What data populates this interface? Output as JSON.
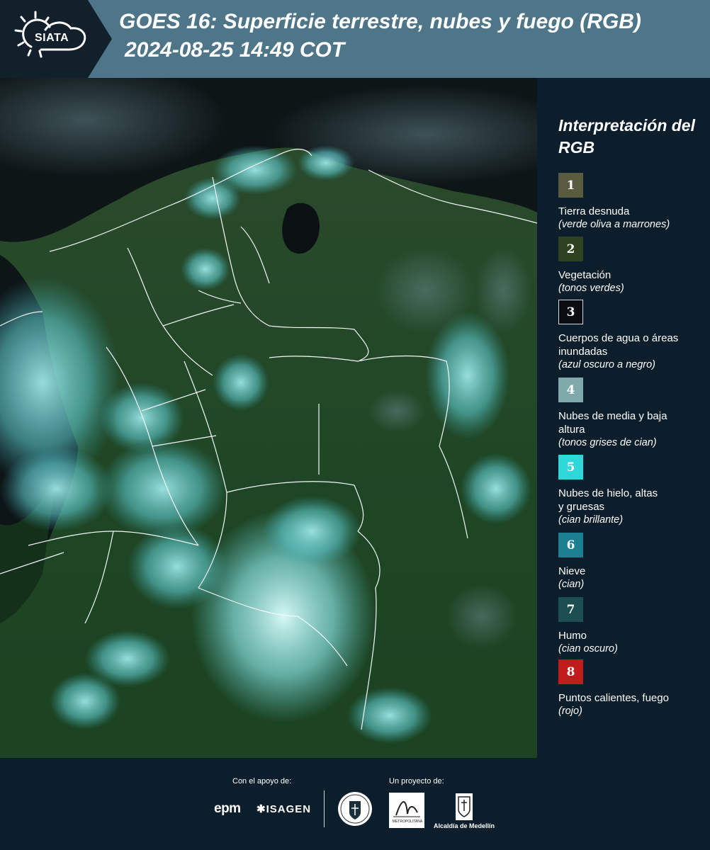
{
  "header": {
    "logo_text": "SIATA",
    "title_line1": "GOES 16: Superficie terrestre, nubes y fuego (RGB)",
    "title_line2": "2024-08-25 14:49 COT"
  },
  "legend": {
    "title": "Interpretación del RGB",
    "items": [
      {
        "number": "1",
        "label": "Tierra desnuda",
        "sub": "(verde oliva a marrones)",
        "color": "#5a5a3e"
      },
      {
        "number": "2",
        "label": "Vegetación",
        "sub": "(tonos verdes)",
        "color": "#2e4222"
      },
      {
        "number": "3",
        "label": "Cuerpos de agua o áreas inundadas",
        "sub": "(azul oscuro a negro)",
        "color": "#0a0d12"
      },
      {
        "number": "4",
        "label": "Nubes de media y baja altura",
        "sub": "(tonos grises de cian)",
        "color": "#7fa9ab"
      },
      {
        "number": "5",
        "label": "Nubes de hielo, altas y gruesas",
        "sub": "(cian brillante)",
        "color": "#2fd7d9"
      },
      {
        "number": "6",
        "label": "Nieve",
        "sub": "(cian)",
        "color": "#1d7f92"
      },
      {
        "number": "7",
        "label": "Humo",
        "sub": "(cian oscuro)",
        "color": "#1c4e52"
      },
      {
        "number": "8",
        "label": "Puntos calientes, fuego",
        "sub": "(rojo)",
        "color": "#c01c1c"
      }
    ]
  },
  "footer": {
    "support_label": "Con el apoyo de:",
    "project_label": "Un proyecto de:",
    "epm": "epm",
    "isagen": "ISAGEN",
    "amva": "METROPOLITANA",
    "alcaldia": "Alcaldía de Medellín"
  }
}
